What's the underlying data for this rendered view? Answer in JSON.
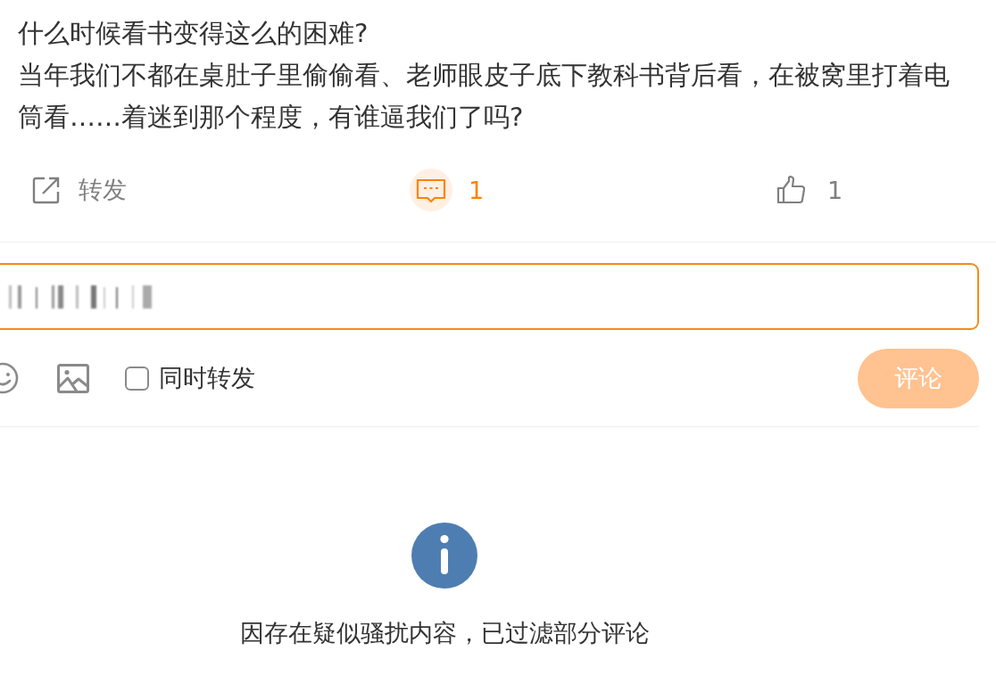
{
  "post": {
    "paragraphs": [
      "什么时候看书变得这么的困难?",
      "当年我们不都在桌肚子里偷偷看、老师眼皮子底下教科书背后看，在被窝里打着电筒看……着迷到那个程度，有谁逼我们了吗?"
    ]
  },
  "actions": [
    {
      "kind": "forward",
      "label": "转发",
      "selected": false
    },
    {
      "kind": "comment",
      "label": "1",
      "selected": true
    },
    {
      "kind": "like",
      "label": "1",
      "selected": false
    }
  ],
  "composer": {
    "input": {
      "focused": true
    },
    "sync_forward": {
      "label": "同时转发",
      "checked": false
    },
    "submit": {
      "label": "评论",
      "disabled": true
    }
  },
  "notice": {
    "text": "因存在疑似骚扰内容，已过滤部分评论"
  }
}
